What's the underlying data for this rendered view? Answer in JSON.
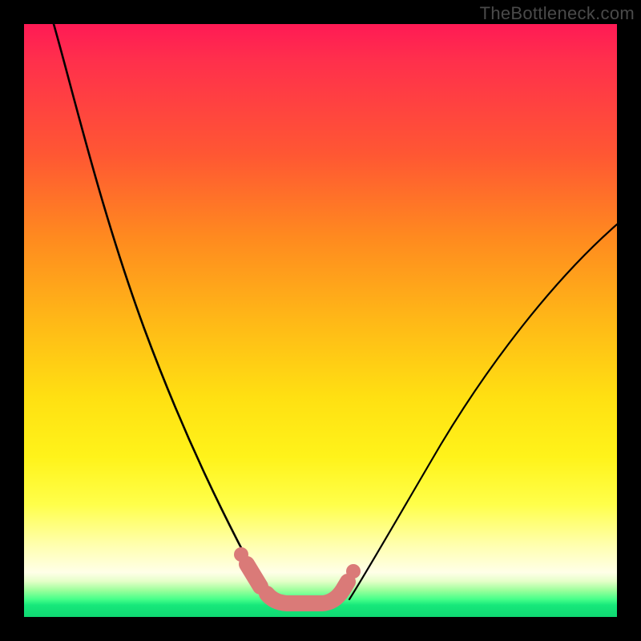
{
  "watermark": "TheBottleneck.com",
  "chart_data": {
    "type": "line",
    "title": "",
    "xlabel": "",
    "ylabel": "",
    "xlim": [
      0,
      100
    ],
    "ylim": [
      0,
      100
    ],
    "background_gradient_stops": [
      {
        "pos": 0,
        "color": "#ff1a55"
      },
      {
        "pos": 22,
        "color": "#ff5733"
      },
      {
        "pos": 50,
        "color": "#ffb817"
      },
      {
        "pos": 73,
        "color": "#fff31a"
      },
      {
        "pos": 92,
        "color": "#ffffe0"
      },
      {
        "pos": 100,
        "color": "#10d873"
      }
    ],
    "series": [
      {
        "name": "left-curve",
        "stroke": "#000000",
        "points": [
          {
            "x": 5,
            "y": 100
          },
          {
            "x": 8,
            "y": 88
          },
          {
            "x": 12,
            "y": 73
          },
          {
            "x": 16,
            "y": 58
          },
          {
            "x": 20,
            "y": 45
          },
          {
            "x": 25,
            "y": 32
          },
          {
            "x": 30,
            "y": 20
          },
          {
            "x": 34,
            "y": 12
          },
          {
            "x": 37,
            "y": 7
          },
          {
            "x": 40,
            "y": 4
          }
        ]
      },
      {
        "name": "right-curve",
        "stroke": "#000000",
        "points": [
          {
            "x": 55,
            "y": 4
          },
          {
            "x": 58,
            "y": 8
          },
          {
            "x": 62,
            "y": 15
          },
          {
            "x": 68,
            "y": 25
          },
          {
            "x": 75,
            "y": 36
          },
          {
            "x": 82,
            "y": 46
          },
          {
            "x": 90,
            "y": 56
          },
          {
            "x": 100,
            "y": 66
          }
        ]
      },
      {
        "name": "bottom-marker-band",
        "stroke": "#d86a6a",
        "style": "thick-rounded",
        "points": [
          {
            "x": 38,
            "y": 6.5
          },
          {
            "x": 40,
            "y": 3.5
          },
          {
            "x": 42,
            "y": 2.5
          },
          {
            "x": 48,
            "y": 2.5
          },
          {
            "x": 51,
            "y": 3.0
          },
          {
            "x": 53,
            "y": 5.0
          },
          {
            "x": 55,
            "y": 6.5
          }
        ]
      }
    ],
    "marker_dots": [
      {
        "x": 37.7,
        "y": 7.3,
        "color": "#d86a6a"
      },
      {
        "x": 54.2,
        "y": 7.5,
        "color": "#d86a6a"
      }
    ]
  }
}
